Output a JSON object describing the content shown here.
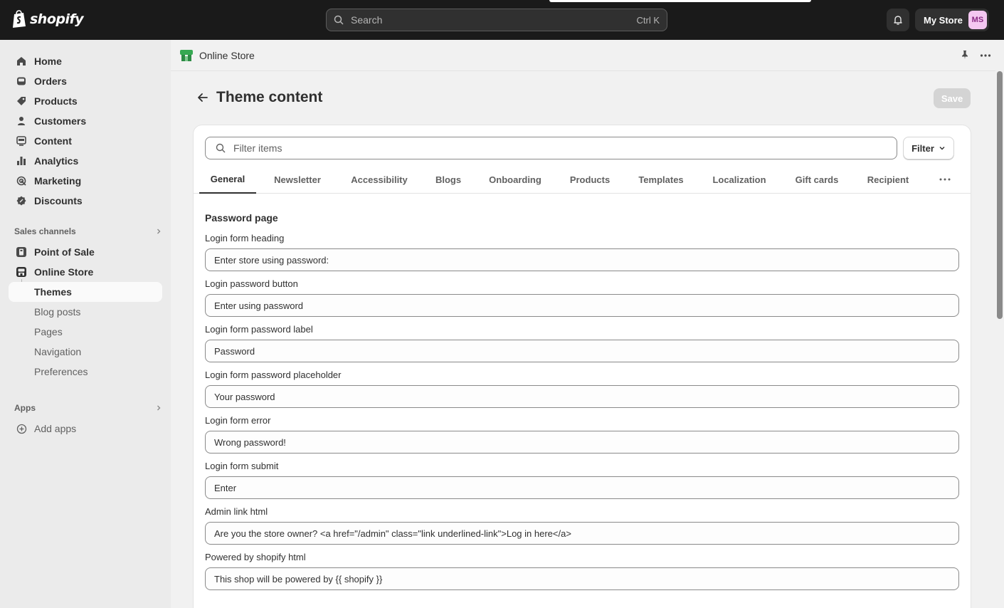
{
  "topbar": {
    "brand": "shopify",
    "search_placeholder": "Search",
    "search_shortcut": "Ctrl K",
    "store_name": "My Store",
    "avatar_initials": "MS"
  },
  "sidebar": {
    "main_items": [
      {
        "label": "Home",
        "icon": "home-icon"
      },
      {
        "label": "Orders",
        "icon": "inbox-icon"
      },
      {
        "label": "Products",
        "icon": "tag-icon"
      },
      {
        "label": "Customers",
        "icon": "person-icon"
      },
      {
        "label": "Content",
        "icon": "content-icon"
      },
      {
        "label": "Analytics",
        "icon": "bar-chart-icon"
      },
      {
        "label": "Marketing",
        "icon": "target-icon"
      },
      {
        "label": "Discounts",
        "icon": "discount-icon"
      }
    ],
    "sales_channels_label": "Sales channels",
    "channels": [
      {
        "label": "Point of Sale",
        "icon": "pos-icon"
      },
      {
        "label": "Online Store",
        "icon": "store-icon"
      }
    ],
    "sub_items": [
      "Themes",
      "Blog posts",
      "Pages",
      "Navigation",
      "Preferences"
    ],
    "active_sub": "Themes",
    "apps_label": "Apps",
    "add_apps": "Add apps"
  },
  "header": {
    "title": "Online Store"
  },
  "page": {
    "title": "Theme content",
    "save_label": "Save"
  },
  "card": {
    "filter_placeholder": "Filter items",
    "filter_label": "Filter",
    "tabs": [
      "General",
      "Newsletter",
      "Accessibility",
      "Blogs",
      "Onboarding",
      "Products",
      "Templates",
      "Localization",
      "Gift cards",
      "Recipient"
    ],
    "active_tab": "General",
    "section_title": "Password page",
    "fields": [
      {
        "label": "Login form heading",
        "value": "Enter store using password:"
      },
      {
        "label": "Login password button",
        "value": "Enter using password"
      },
      {
        "label": "Login form password label",
        "value": "Password"
      },
      {
        "label": "Login form password placeholder",
        "value": "Your password"
      },
      {
        "label": "Login form error",
        "value": "Wrong password!"
      },
      {
        "label": "Login form submit",
        "value": "Enter"
      },
      {
        "label": "Admin link html",
        "value": "Are you the store owner? <a href=\"/admin\" class=\"link underlined-link\">Log in here</a>"
      },
      {
        "label": "Powered by shopify html",
        "value": "This shop will be powered by {{ shopify }}"
      }
    ]
  },
  "colors": {
    "topbar_bg": "#1a1a1a",
    "sidebar_bg": "#ebebeb",
    "page_bg": "#f1f1f1",
    "avatar_bg": "#f4c7f1",
    "store_icon_green": "#36a852"
  }
}
